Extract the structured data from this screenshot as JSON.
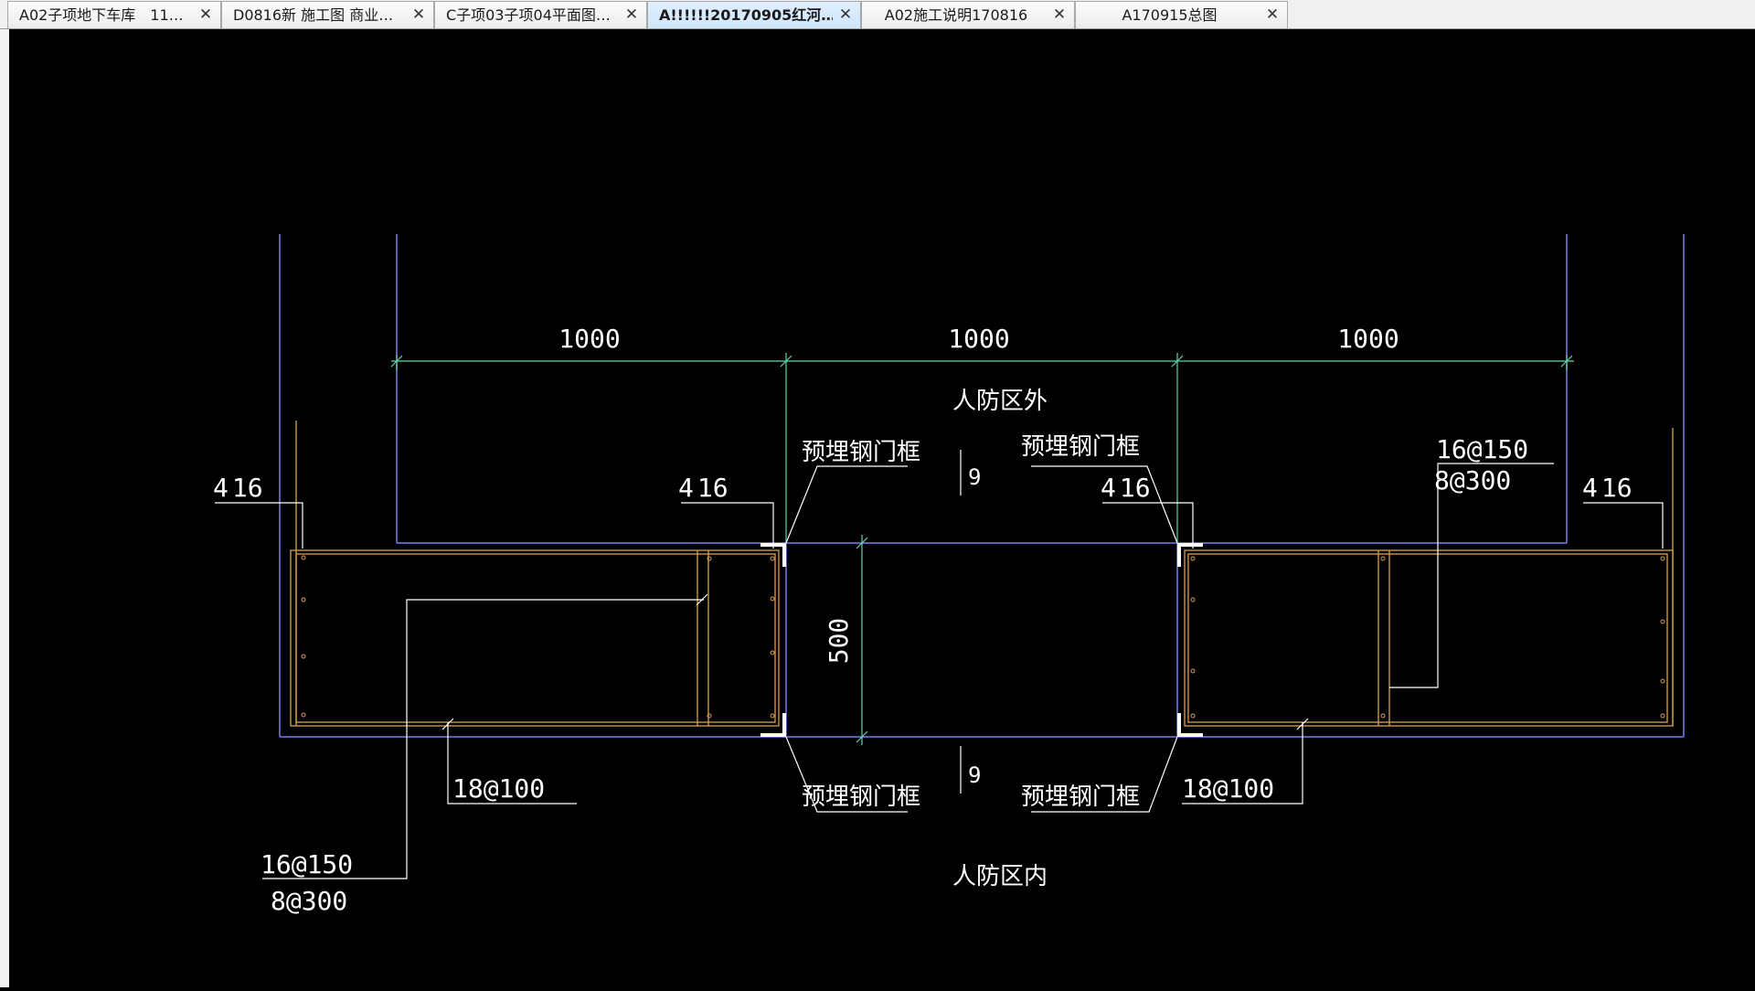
{
  "tabs": [
    {
      "label": "A02子项地下车库　11…",
      "active": false
    },
    {
      "label": "D0816新 施工图 商业…",
      "active": false
    },
    {
      "label": "C子项03子项04平面图…",
      "active": false
    },
    {
      "label": "A!!!!!!20170905红河…",
      "active": true
    },
    {
      "label": "A02施工说明170816",
      "active": false
    },
    {
      "label": "A170915总图",
      "active": false
    }
  ],
  "tab_close_glyph": "✕",
  "colors": {
    "background": "#000000",
    "wall_line": "#7c7cf0",
    "dimension_line": "#5fd7a8",
    "rebar_line": "#d8a24a",
    "leader_line": "#ffffff",
    "text": "#ffffff"
  },
  "drawing": {
    "dim_top": [
      "1000",
      "1000",
      "1000"
    ],
    "dim_vertical": "500",
    "zone_outside": "人防区外",
    "zone_inside": "人防区内",
    "door_frame_label": "预埋钢门框",
    "rebar_left_top": "4",
    "rebar_left_top_sub": "16",
    "rebar_mid_left": "4",
    "rebar_mid_left_sub": "16",
    "rebar_mid_right": "4",
    "rebar_mid_right_sub": "16",
    "rebar_right": "4",
    "rebar_right_sub": "16",
    "rebar_right_dist_1": "16@150",
    "rebar_right_dist_2": "8@300",
    "rebar_left_dist_1": "16@150",
    "rebar_left_dist_2": "8@300",
    "stirrup_left": "18@100",
    "stirrup_right": "18@100",
    "gap_top": "9",
    "gap_bottom": "9"
  }
}
